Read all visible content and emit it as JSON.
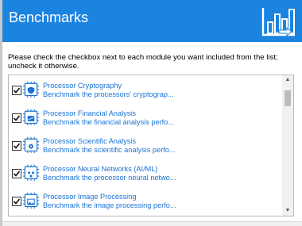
{
  "window": {
    "title": "Benchmarks",
    "header_color": "#1b84e0",
    "header_icon": "benchmark-chart-icon"
  },
  "instructions": "Please check the checkbox next to each module you want included from the list; uncheck it otherwise.",
  "modules": [
    {
      "title": "Processor Cryptography",
      "description": "Benchmark the processors' cryptograp...",
      "checked": true,
      "icon": "chip-shield-icon"
    },
    {
      "title": "Processor Financial Analysis",
      "description": "Benchmark the financial analysis perfo...",
      "checked": true,
      "icon": "chip-finance-icon"
    },
    {
      "title": "Processor Scientific Analysis",
      "description": "Benchmark the scientific analysis perfo...",
      "checked": true,
      "icon": "chip-science-icon"
    },
    {
      "title": "Processor Neural Networks (AI/ML)",
      "description": "Benchmark the processor neural netwo...",
      "checked": true,
      "icon": "chip-neural-icon"
    },
    {
      "title": "Processor Image Processing",
      "description": "Benchmark the image processing perfo...",
      "checked": true,
      "icon": "chip-image-icon"
    }
  ],
  "colors": {
    "accent": "#1b84e0",
    "link_text": "#1a73d4"
  }
}
